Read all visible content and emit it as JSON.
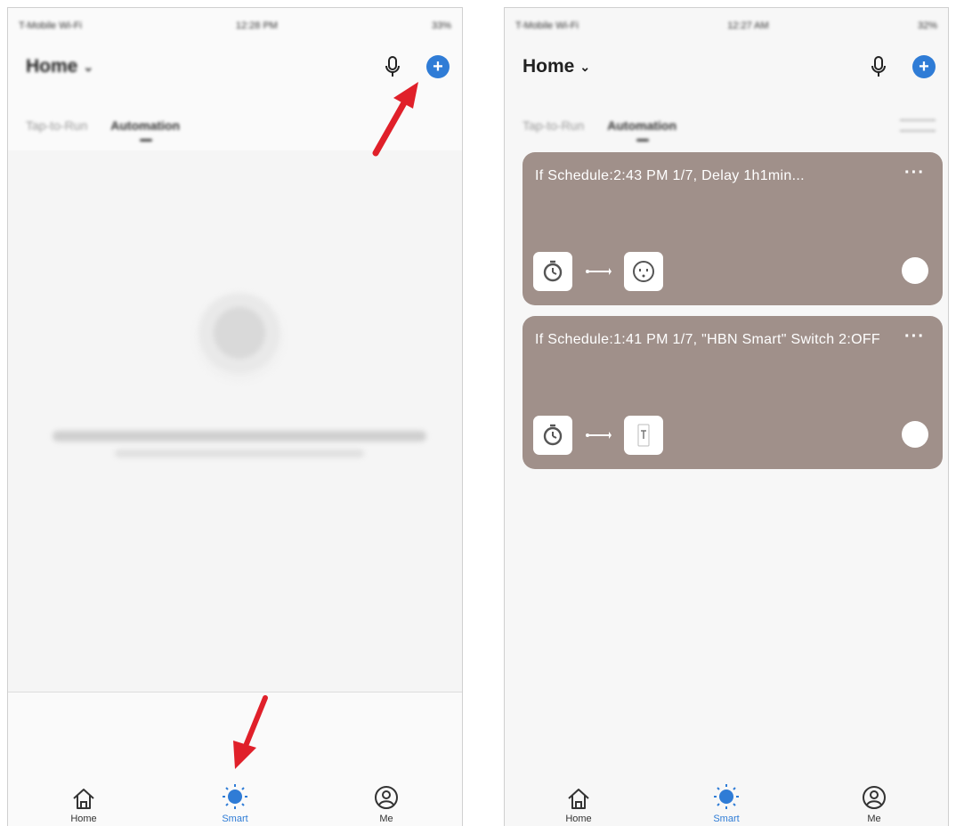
{
  "screens": [
    {
      "id": "left",
      "status": {
        "carrier": "T-Mobile Wi-Fi",
        "time": "12:28 PM",
        "battery": "33%"
      },
      "header": {
        "title": "Home"
      },
      "tabs": [
        {
          "label": "Tap-to-Run"
        },
        {
          "label": "Automation"
        }
      ],
      "empty_state": {
        "message": "",
        "hint": ""
      }
    },
    {
      "id": "right",
      "status": {
        "carrier": "T-Mobile Wi-Fi",
        "time": "12:27 AM",
        "battery": "32%"
      },
      "header": {
        "title": "Home"
      },
      "tabs": [
        {
          "label": "Tap-to-Run"
        },
        {
          "label": "Automation"
        }
      ],
      "automations": [
        {
          "title": "If Schedule:2:43 PM 1/7, Delay 1h1min...",
          "condition_icon": "clock-icon",
          "action_icon": "plug-icon"
        },
        {
          "title": "If Schedule:1:41 PM 1/7, \"HBN Smart\" Switch 2:OFF",
          "condition_icon": "clock-icon",
          "action_icon": "switch-icon"
        }
      ]
    }
  ],
  "bottom_nav": [
    {
      "label": "Home",
      "icon": "home-icon"
    },
    {
      "label": "Smart",
      "icon": "smart-icon"
    },
    {
      "label": "Me",
      "icon": "user-icon"
    }
  ],
  "colors": {
    "accent": "#2f7cd6",
    "card": "#a0908a",
    "pointer": "#e0202a"
  }
}
